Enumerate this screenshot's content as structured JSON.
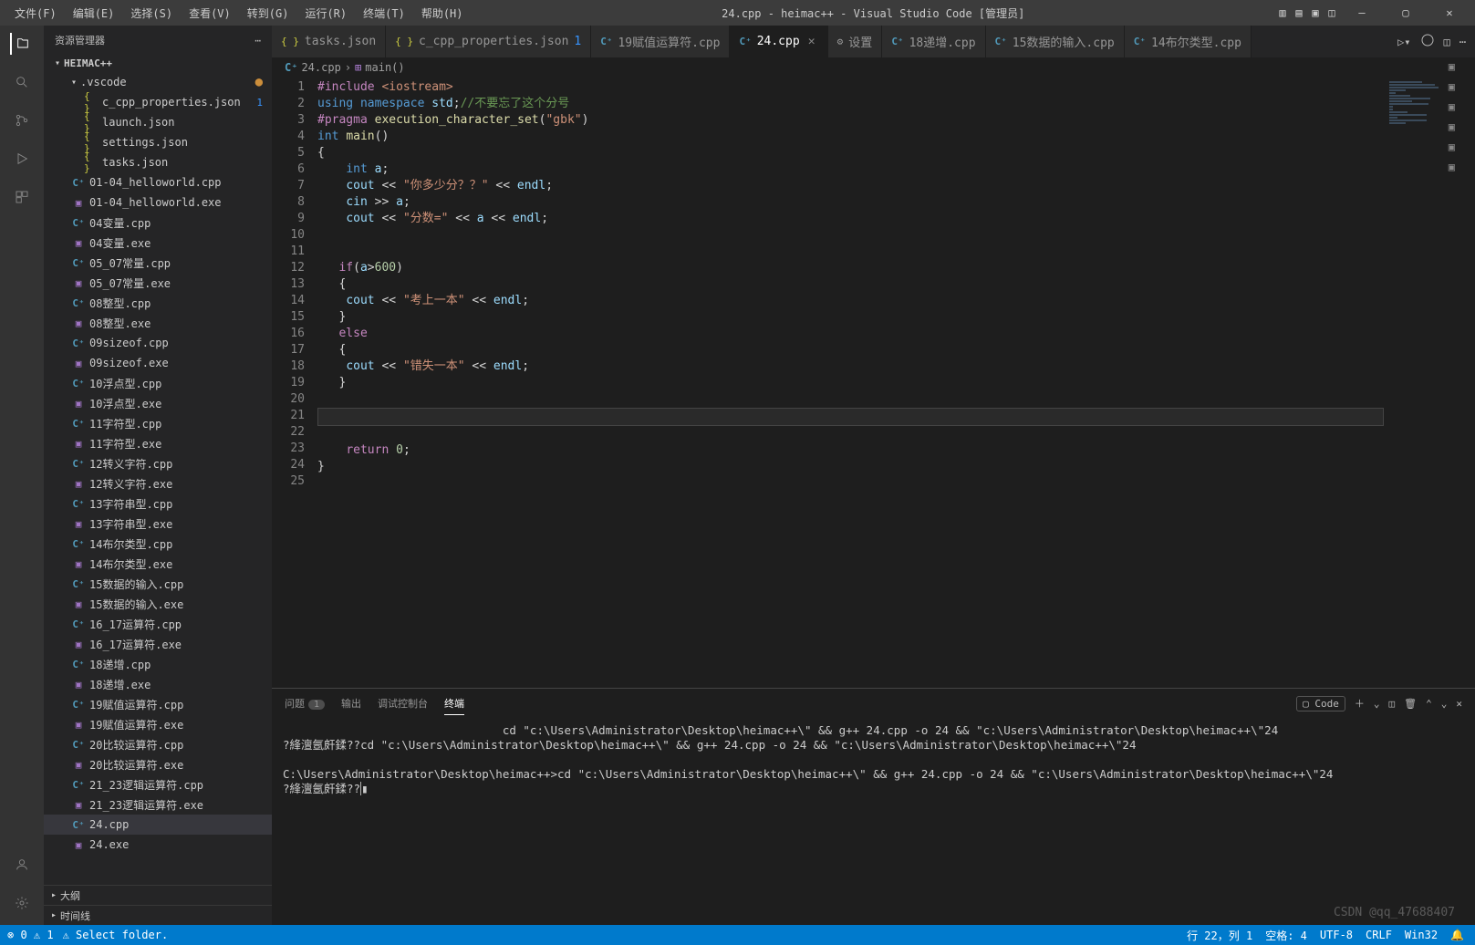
{
  "menu": [
    "文件(F)",
    "编辑(E)",
    "选择(S)",
    "查看(V)",
    "转到(G)",
    "运行(R)",
    "终端(T)",
    "帮助(H)"
  ],
  "window_title": "24.cpp - heimac++ - Visual Studio Code [管理员]",
  "explorer": {
    "title": "资源管理器",
    "project": "HEIMAC++",
    "vscode_folder": ".vscode",
    "vscode_files": [
      {
        "name": "c_cpp_properties.json",
        "icon": "json",
        "badge": "1"
      },
      {
        "name": "launch.json",
        "icon": "json"
      },
      {
        "name": "settings.json",
        "icon": "json"
      },
      {
        "name": "tasks.json",
        "icon": "json"
      }
    ],
    "files": [
      {
        "name": "01-04_helloworld.cpp",
        "icon": "cpp"
      },
      {
        "name": "01-04_helloworld.exe",
        "icon": "exe"
      },
      {
        "name": "04变量.cpp",
        "icon": "cpp"
      },
      {
        "name": "04变量.exe",
        "icon": "exe"
      },
      {
        "name": "05_07常量.cpp",
        "icon": "cpp"
      },
      {
        "name": "05_07常量.exe",
        "icon": "exe"
      },
      {
        "name": "08整型.cpp",
        "icon": "cpp"
      },
      {
        "name": "08整型.exe",
        "icon": "exe"
      },
      {
        "name": "09sizeof.cpp",
        "icon": "cpp"
      },
      {
        "name": "09sizeof.exe",
        "icon": "exe"
      },
      {
        "name": "10浮点型.cpp",
        "icon": "cpp"
      },
      {
        "name": "10浮点型.exe",
        "icon": "exe"
      },
      {
        "name": "11字符型.cpp",
        "icon": "cpp"
      },
      {
        "name": "11字符型.exe",
        "icon": "exe"
      },
      {
        "name": "12转义字符.cpp",
        "icon": "cpp"
      },
      {
        "name": "12转义字符.exe",
        "icon": "exe"
      },
      {
        "name": "13字符串型.cpp",
        "icon": "cpp"
      },
      {
        "name": "13字符串型.exe",
        "icon": "exe"
      },
      {
        "name": "14布尔类型.cpp",
        "icon": "cpp"
      },
      {
        "name": "14布尔类型.exe",
        "icon": "exe"
      },
      {
        "name": "15数据的输入.cpp",
        "icon": "cpp"
      },
      {
        "name": "15数据的输入.exe",
        "icon": "exe"
      },
      {
        "name": "16_17运算符.cpp",
        "icon": "cpp"
      },
      {
        "name": "16_17运算符.exe",
        "icon": "exe"
      },
      {
        "name": "18递增.cpp",
        "icon": "cpp"
      },
      {
        "name": "18递增.exe",
        "icon": "exe"
      },
      {
        "name": "19赋值运算符.cpp",
        "icon": "cpp"
      },
      {
        "name": "19赋值运算符.exe",
        "icon": "exe"
      },
      {
        "name": "20比较运算符.cpp",
        "icon": "cpp"
      },
      {
        "name": "20比较运算符.exe",
        "icon": "exe"
      },
      {
        "name": "21_23逻辑运算符.cpp",
        "icon": "cpp"
      },
      {
        "name": "21_23逻辑运算符.exe",
        "icon": "exe"
      },
      {
        "name": "24.cpp",
        "icon": "cpp",
        "active": true
      },
      {
        "name": "24.exe",
        "icon": "exe"
      }
    ],
    "outline": "大纲",
    "timeline": "时间线"
  },
  "tabs": [
    {
      "label": "tasks.json",
      "icon": "json"
    },
    {
      "label": "c_cpp_properties.json",
      "icon": "json",
      "mod": "1"
    },
    {
      "label": "19赋值运算符.cpp",
      "icon": "cpp"
    },
    {
      "label": "24.cpp",
      "icon": "cpp",
      "active": true,
      "close": true
    },
    {
      "label": "设置",
      "icon": "gear"
    },
    {
      "label": "18递增.cpp",
      "icon": "cpp"
    },
    {
      "label": "15数据的输入.cpp",
      "icon": "cpp"
    },
    {
      "label": "14布尔类型.cpp",
      "icon": "cpp"
    }
  ],
  "breadcrumb": {
    "file": "24.cpp",
    "sym": "main()"
  },
  "code": {
    "lines": [
      "1",
      "2",
      "3",
      "4",
      "5",
      "6",
      "7",
      "8",
      "9",
      "10",
      "11",
      "12",
      "13",
      "14",
      "15",
      "16",
      "17",
      "18",
      "19",
      "20",
      "21",
      "22",
      "23",
      "24",
      "25"
    ]
  },
  "panel": {
    "tabs": {
      "problems": "问题",
      "problems_count": "1",
      "output": "输出",
      "debug": "调试控制台",
      "terminal": "终端"
    },
    "code_btn": "Code",
    "terminal_text": "                                cd \"c:\\Users\\Administrator\\Desktop\\heimac++\\\" && g++ 24.cpp -o 24 && \"c:\\Users\\Administrator\\Desktop\\heimac++\\\"24\n?綘澶氬皯鍒??cd \"c:\\Users\\Administrator\\Desktop\\heimac++\\\" && g++ 24.cpp -o 24 && \"c:\\Users\\Administrator\\Desktop\\heimac++\\\"24\n\nC:\\Users\\Administrator\\Desktop\\heimac++>cd \"c:\\Users\\Administrator\\Desktop\\heimac++\\\" && g++ 24.cpp -o 24 && \"c:\\Users\\Administrator\\Desktop\\heimac++\\\"24\n?綘澶氬皯鍒??"
  },
  "status": {
    "errors": "⊗ 0 ⚠ 1",
    "select_folder": "⚠ Select folder.",
    "line": "行 22，列 1",
    "spaces": "空格: 4",
    "encoding": "UTF-8",
    "eol": "CRLF",
    "lang": "Win32",
    "bell": "🔔"
  },
  "watermark": "CSDN @qq_47688407"
}
